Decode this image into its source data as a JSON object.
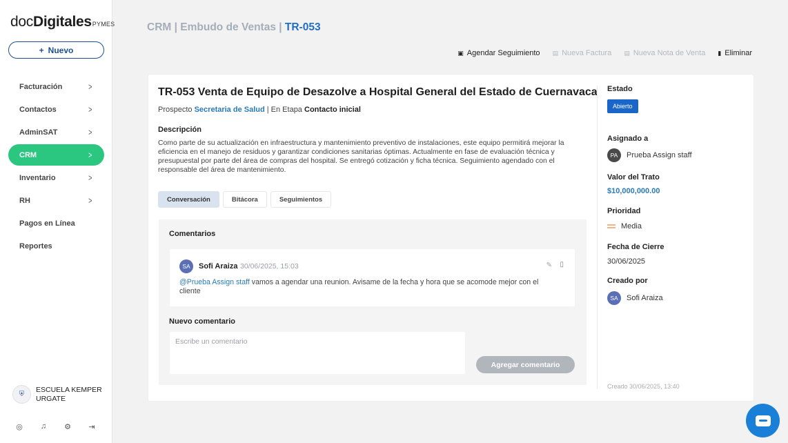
{
  "app": {
    "logo_doc": "doc",
    "logo_digitales": "Digitales",
    "logo_pymes": "PYMES",
    "new_button": "Nuevo"
  },
  "sidebar": {
    "items": [
      {
        "label": "Facturación",
        "chevron": true,
        "active": false
      },
      {
        "label": "Contactos",
        "chevron": true,
        "active": false
      },
      {
        "label": "AdminSAT",
        "chevron": true,
        "active": false
      },
      {
        "label": "CRM",
        "chevron": true,
        "active": true
      },
      {
        "label": "Inventario",
        "chevron": true,
        "active": false
      },
      {
        "label": "RH",
        "chevron": true,
        "active": false
      },
      {
        "label": "Pagos en Línea",
        "chevron": false,
        "active": false
      },
      {
        "label": "Reportes",
        "chevron": false,
        "active": false
      }
    ],
    "school_name": "ESCUELA KEMPER URGATE",
    "bottom_icons": [
      "user-circle-icon",
      "bell-icon",
      "gear-icon",
      "logout-icon"
    ]
  },
  "header": {
    "breadcrumb_crm": "CRM",
    "breadcrumb_sep1": " | ",
    "breadcrumb_funnel": "Embudo de Ventas",
    "breadcrumb_sep2": " | ",
    "breadcrumb_current": "TR-053",
    "actions": {
      "schedule": "Agendar Seguimiento",
      "invoice": "Nueva Factura",
      "sale_note": "Nueva Nota de Venta",
      "delete": "Eliminar"
    }
  },
  "deal": {
    "title": "TR-053  Venta de Equipo de Desazolve a Hospital General del Estado de Cuernavaca",
    "prospect_prefix": "Prospecto ",
    "prospect_name": "Secretaria de Salud",
    "stage_prefix": " | En Etapa ",
    "stage": "Contacto inicial",
    "description_label": "Descripción",
    "description": "Como parte de su actualización en infraestructura y mantenimiento preventivo de instalaciones, este equipo permitirá mejorar la eficiencia en el manejo de residuos y garantizar condiciones sanitarias óptimas. Actualmente en fase de evaluación técnica y presupuestal por parte del área de compras del hospital. Se entregó cotización y ficha técnica. Seguimiento agendado con el responsable del área de mantenimiento."
  },
  "tabs": [
    {
      "label": "Conversación",
      "active": true
    },
    {
      "label": "Bitácora",
      "active": false
    },
    {
      "label": "Seguimientos",
      "active": false
    }
  ],
  "comments": {
    "title": "Comentarios",
    "items": [
      {
        "initials": "SA",
        "author": "Sofi Araiza",
        "date": "30/06/2025, 15:03",
        "mention": "@Prueba Assign staff",
        "text": " vamos a agendar una reunion. Avisame de la fecha y hora que se acomode mejor con el cliente"
      }
    ],
    "new_label": "Nuevo comentario",
    "placeholder": "Escribe un comentario",
    "submit": "Agregar comentario"
  },
  "details": {
    "status_label": "Estado",
    "status": "Abierto",
    "assigned_label": "Asignado a",
    "assigned_initials": "PA",
    "assigned_name": "Prueba Assign staff",
    "value_label": "Valor del Trato",
    "value": "$10,000,000.00",
    "priority_label": "Prioridad",
    "priority": "Media",
    "close_label": "Fecha de Cierre",
    "close_date": "30/06/2025",
    "created_by_label": "Creado por",
    "created_by_initials": "SA",
    "created_by": "Sofi Araiza",
    "created_footer": "Creado 30/06/2025, 13:40"
  },
  "colors": {
    "accent": "#1f6fc4",
    "active_nav": "#2bc781",
    "status_badge": "#1966c8",
    "chat": "#1a7fd6"
  }
}
